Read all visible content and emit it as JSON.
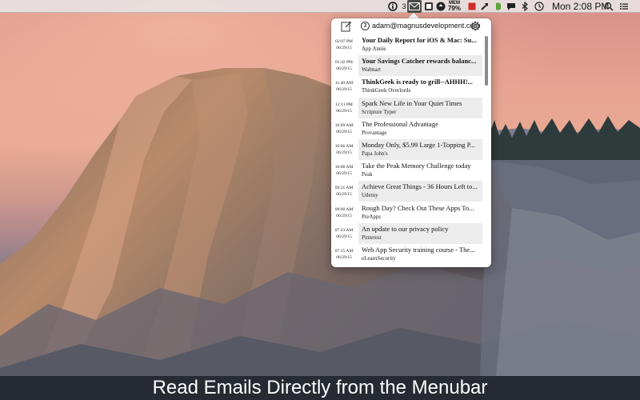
{
  "menubar": {
    "mail_badge_count": "3",
    "memory_label": "MEM",
    "memory_value": "79%",
    "clock": "Mon 2:08 PM",
    "icons": [
      "info-icon",
      "mail-icon",
      "screenshot-icon",
      "update-icon",
      "memory-icon",
      "red-square-icon",
      "hammer-icon",
      "evernote-icon",
      "chat-icon",
      "bluetooth-icon",
      "wifi-icon",
      "time-machine-icon",
      "spotlight-icon",
      "notification-center-icon"
    ]
  },
  "panel": {
    "account_count": "3",
    "account_email": "adam@magnusdevelopment.com",
    "emails": [
      {
        "time": "02:07 PM",
        "date": "06/29/15",
        "subject": "Your Daily Report for iOS & Mac: Su...",
        "sender": "App Annie",
        "unread": true
      },
      {
        "time": "01:42 PM",
        "date": "06/29/15",
        "subject": "Your Savings Catcher rewards balanc...",
        "sender": "Walmart",
        "unread": true
      },
      {
        "time": "11:40 AM",
        "date": "06/29/15",
        "subject": "ThinkGeek is ready to grill--AHHH!...",
        "sender": "ThinkGeek Overlords",
        "unread": true
      },
      {
        "time": "12:11 PM",
        "date": "06/29/15",
        "subject": "Spark New Life in Your Quiet Times",
        "sender": "Scripture Typer",
        "unread": false
      },
      {
        "time": "10:09 AM",
        "date": "06/29/15",
        "subject": "The Professional Advantage",
        "sender": "Provantage",
        "unread": false
      },
      {
        "time": "10:06 AM",
        "date": "06/29/15",
        "subject": "Monday Only, $5.99 Large 1-Topping P...",
        "sender": "Papa John's",
        "unread": false
      },
      {
        "time": "10:08 AM",
        "date": "06/29/15",
        "subject": "Take the Peak Memory Challenge today",
        "sender": "Peak",
        "unread": false
      },
      {
        "time": "09:21 AM",
        "date": "06/29/15",
        "subject": "Achieve Great Things - 36 Hours Left to...",
        "sender": "Udemy",
        "unread": false
      },
      {
        "time": "08:00 AM",
        "date": "06/29/15",
        "subject": "Rough Day? Check Out These Apps To...",
        "sender": "PreApps",
        "unread": false
      },
      {
        "time": "07:23 AM",
        "date": "06/29/15",
        "subject": "An update to our privacy policy",
        "sender": "Pinterest",
        "unread": false
      },
      {
        "time": "07:15 AM",
        "date": "06/29/15",
        "subject": "Web App Security training course - The...",
        "sender": "eLearnSecurity",
        "unread": false
      }
    ]
  },
  "caption": "Read Emails Directly from the Menubar",
  "colors": {
    "menubar_bg": "#e8e2e2",
    "row_alt_bg": "#ececec",
    "caption_bg": "#14181e"
  }
}
